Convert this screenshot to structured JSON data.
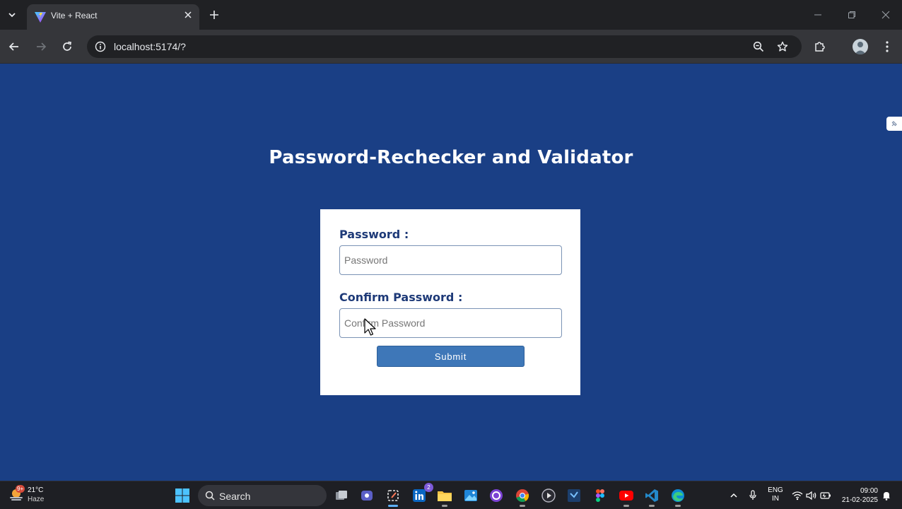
{
  "browser": {
    "tab_title": "Vite + React",
    "url": "localhost:5174/?"
  },
  "page": {
    "title": "Password-Rechecker and Validator",
    "password_label": "Password :",
    "password_placeholder": "Password",
    "password_value": "",
    "confirm_label": "Confirm Password :",
    "confirm_placeholder": "Confirm Password",
    "confirm_value": "",
    "submit_label": "Submit"
  },
  "colors": {
    "page_background": "#1a3f85",
    "label_color": "#1e3a78",
    "button_color": "#3e77b8"
  },
  "taskbar": {
    "weather_temp": "21°C",
    "weather_condition": "Haze",
    "weather_badge": "9+",
    "search_placeholder": "Search",
    "linkedin_badge": "2",
    "lang_line1": "ENG",
    "lang_line2": "IN",
    "time": "09:00",
    "date": "21-02-2025",
    "apps": [
      "task-view",
      "teams-meet",
      "snipping-tool",
      "linkedin",
      "file-explorer",
      "photos",
      "github-desktop",
      "chrome",
      "media-player",
      "visual-studio",
      "figma",
      "youtube",
      "vscode",
      "edge"
    ]
  }
}
